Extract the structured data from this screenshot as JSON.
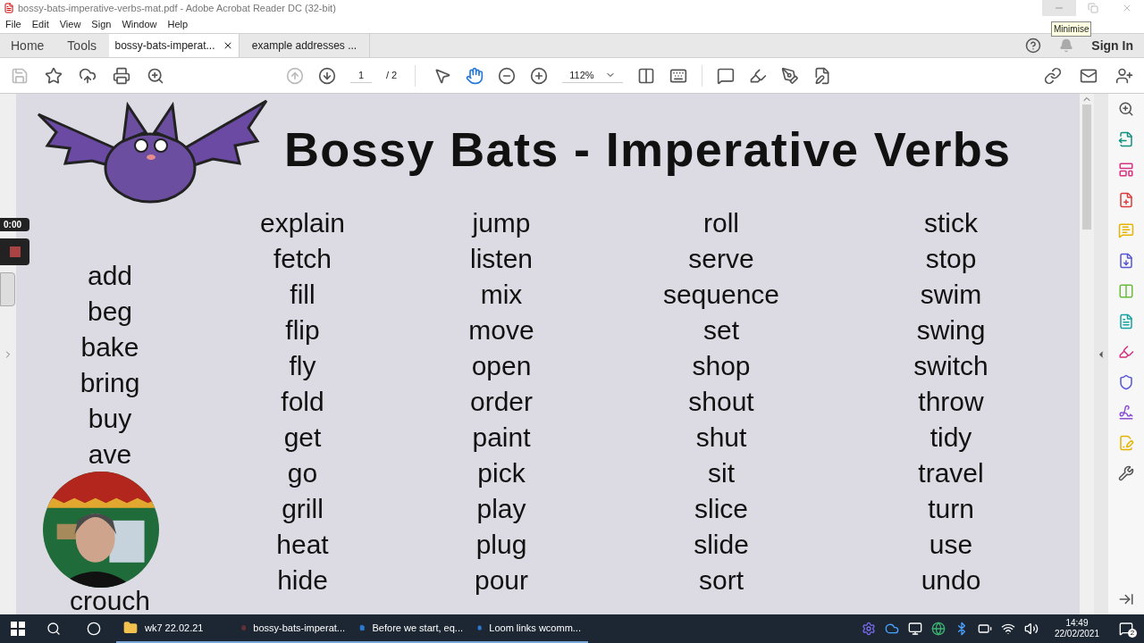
{
  "window": {
    "title": "bossy-bats-imperative-verbs-mat.pdf - Adobe Acrobat Reader DC (32-bit)",
    "tooltip": "Minimise"
  },
  "menu": [
    "File",
    "Edit",
    "View",
    "Sign",
    "Window",
    "Help"
  ],
  "nav": [
    "Home",
    "Tools"
  ],
  "tabs": [
    {
      "label": "bossy-bats-imperat...",
      "selected": true
    },
    {
      "label": "example addresses ...",
      "selected": false
    }
  ],
  "sign_in": "Sign In",
  "toolbar": {
    "page": "1",
    "page_count": "/ 2",
    "zoom": "112%"
  },
  "document": {
    "title": "Bossy Bats - Imperative Verbs",
    "side_column": [
      "add",
      "beg",
      "bake",
      "bring",
      "buy",
      "ave"
    ],
    "side_column_end": "crouch",
    "columns": [
      [
        "explain",
        "fetch",
        "fill",
        "flip",
        "fly",
        "fold",
        "get",
        "go",
        "grill",
        "heat",
        "hide"
      ],
      [
        "jump",
        "listen",
        "mix",
        "move",
        "open",
        "order",
        "paint",
        "pick",
        "play",
        "plug",
        "pour"
      ],
      [
        "roll",
        "serve",
        "sequence",
        "set",
        "shop",
        "shout",
        "shut",
        "sit",
        "slice",
        "slide",
        "sort"
      ],
      [
        "stick",
        "stop",
        "swim",
        "swing",
        "switch",
        "throw",
        "tidy",
        "travel",
        "turn",
        "use",
        "undo"
      ]
    ]
  },
  "recorder": {
    "time": "0:00"
  },
  "taskbar": {
    "items": [
      {
        "kind": "folder",
        "label": "wk7 22.02.21"
      },
      {
        "kind": "pdf",
        "label": "bossy-bats-imperat..."
      },
      {
        "kind": "word",
        "label": "Before we start, eq..."
      },
      {
        "kind": "word",
        "label": "Loom links wcomm..."
      }
    ],
    "time": "14:49",
    "date": "22/02/2021",
    "notifications": "2"
  }
}
